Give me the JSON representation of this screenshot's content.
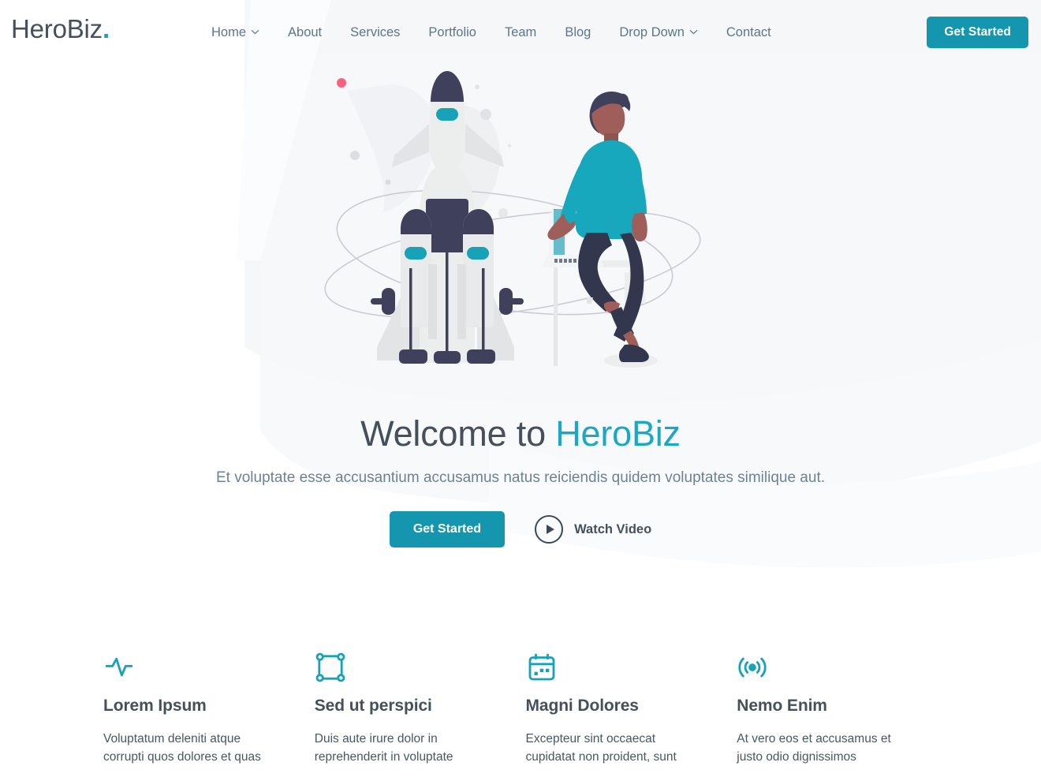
{
  "brand": {
    "name": "HeroBiz",
    "dot": ".",
    "accent_color": "#17a2b8",
    "text_color": "#45505b"
  },
  "header": {
    "nav": [
      {
        "label": "Home",
        "has_dropdown": true,
        "icon": "chevron-down-icon"
      },
      {
        "label": "About",
        "has_dropdown": false,
        "icon": ""
      },
      {
        "label": "Services",
        "has_dropdown": false,
        "icon": ""
      },
      {
        "label": "Portfolio",
        "has_dropdown": false,
        "icon": ""
      },
      {
        "label": "Team",
        "has_dropdown": false,
        "icon": ""
      },
      {
        "label": "Blog",
        "has_dropdown": false,
        "icon": ""
      },
      {
        "label": "Drop Down",
        "has_dropdown": true,
        "icon": "chevron-down-icon"
      },
      {
        "label": "Contact",
        "has_dropdown": false,
        "icon": ""
      }
    ],
    "cta_label": "Get Started",
    "cta_color": "#1497ae"
  },
  "hero": {
    "title_lead": "Welcome to ",
    "title_accent": "HeroBiz",
    "subtitle": "Et voluptate esse accusantium accusamus natus reiciendis quidem voluptates similique aut.",
    "primary_button": "Get Started",
    "secondary_button": "Watch Video",
    "secondary_icon": "play-circle-icon",
    "illustration": "rocket-launch-with-developer-illustration"
  },
  "features": [
    {
      "icon": "activity-pulse-icon",
      "title": "Lorem Ipsum",
      "text": "Voluptatum deleniti atque corrupti quos dolores et quas"
    },
    {
      "icon": "bounding-box-icon",
      "title": "Sed ut perspici",
      "text": "Duis aute irure dolor in reprehenderit in voluptate"
    },
    {
      "icon": "calendar-icon",
      "title": "Magni Dolores",
      "text": "Excepteur sint occaecat cupidatat non proident, sunt"
    },
    {
      "icon": "broadcast-icon",
      "title": "Nemo Enim",
      "text": "At vero eos et accusamus et justo odio dignissimos"
    }
  ]
}
